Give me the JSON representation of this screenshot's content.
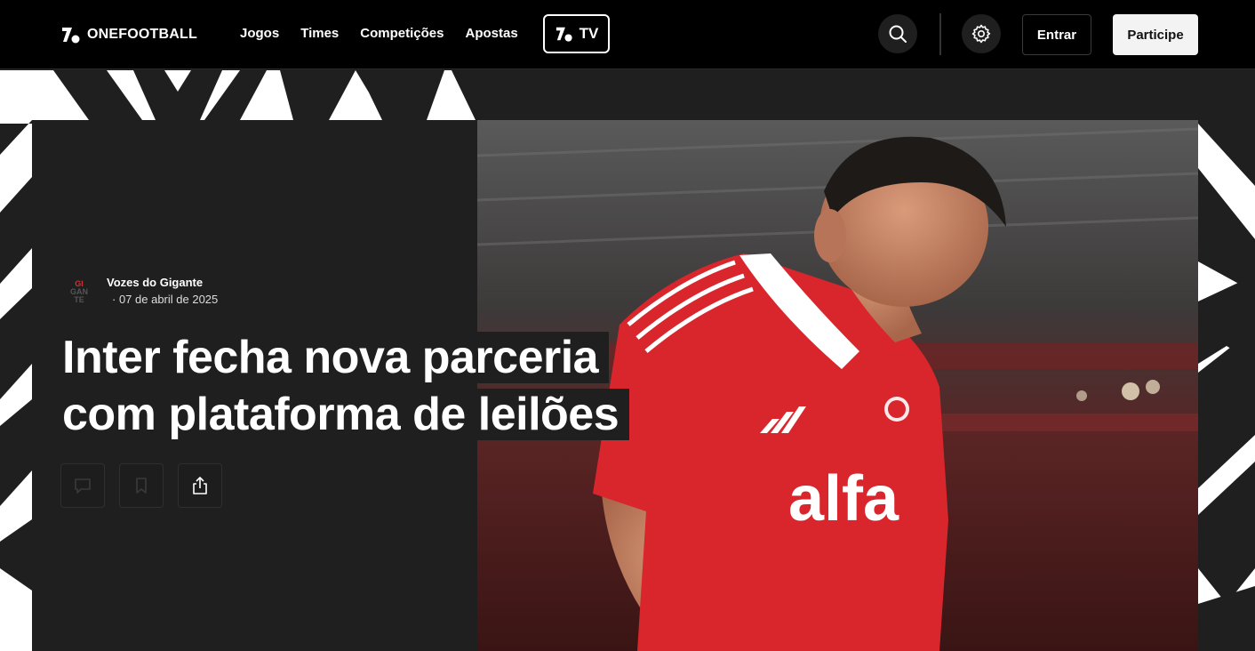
{
  "header": {
    "brand": "ONEFOOTBALL",
    "nav": [
      "Jogos",
      "Times",
      "Competições",
      "Apostas"
    ],
    "tv_label": "TV",
    "login_label": "Entrar",
    "signup_label": "Participe"
  },
  "icons": {
    "search": "search-icon",
    "settings": "gear-icon",
    "comments": "comment-icon",
    "bookmark": "bookmark-icon",
    "share": "share-icon"
  },
  "article": {
    "source_name": "Vozes do Gigante",
    "source_logo_text": [
      "GI",
      "GAN",
      "TE"
    ],
    "date": "07 de abril de 2025",
    "title_line1": "Inter fecha nova parceria",
    "title_line2": "com plataforma de leilões",
    "shirt_text": "alfa"
  },
  "colors": {
    "header_bg": "#000000",
    "panel_bg": "#1f1f1f",
    "accent_white": "#ffffff",
    "jersey_red": "#d8262c"
  }
}
